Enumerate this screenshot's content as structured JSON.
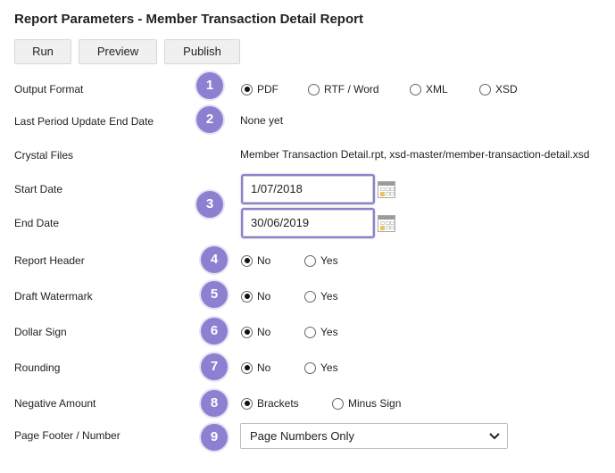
{
  "title": "Report Parameters - Member Transaction Detail Report",
  "toolbar": {
    "run_label": "Run",
    "preview_label": "Preview",
    "publish_label": "Publish"
  },
  "badges": [
    "1",
    "2",
    "3",
    "4",
    "5",
    "6",
    "7",
    "8",
    "9"
  ],
  "output_format": {
    "label": "Output Format",
    "options": [
      "PDF",
      "RTF / Word",
      "XML",
      "XSD"
    ],
    "selected": "PDF"
  },
  "last_period": {
    "label": "Last Period Update End Date",
    "value": "None yet"
  },
  "crystal_files": {
    "label": "Crystal Files",
    "value": "Member Transaction Detail.rpt, xsd-master/member-transaction-detail.xsd"
  },
  "start_date": {
    "label": "Start Date",
    "value": "1/07/2018"
  },
  "end_date": {
    "label": "End Date",
    "value": "30/06/2019"
  },
  "report_header": {
    "label": "Report Header",
    "options": [
      "No",
      "Yes"
    ],
    "selected": "No"
  },
  "draft_watermark": {
    "label": "Draft Watermark",
    "options": [
      "No",
      "Yes"
    ],
    "selected": "No"
  },
  "dollar_sign": {
    "label": "Dollar Sign",
    "options": [
      "No",
      "Yes"
    ],
    "selected": "No"
  },
  "rounding": {
    "label": "Rounding",
    "options": [
      "No",
      "Yes"
    ],
    "selected": "No"
  },
  "negative_amount": {
    "label": "Negative Amount",
    "options": [
      "Brackets",
      "Minus Sign"
    ],
    "selected": "Brackets"
  },
  "page_footer": {
    "label": "Page Footer / Number",
    "selected": "Page Numbers Only"
  },
  "colors": {
    "badge": "#8d80d1",
    "highlight_border": "#8d80d1",
    "button_bg": "#f0f0f0"
  }
}
